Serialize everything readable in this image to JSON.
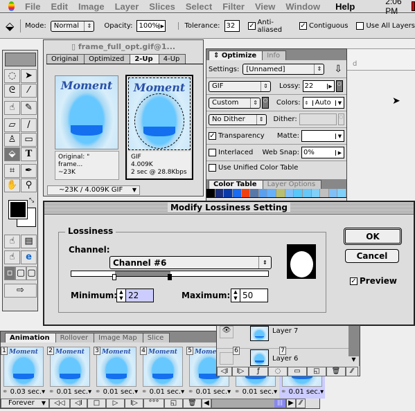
{
  "menubar": {
    "items": [
      "File",
      "Edit",
      "Image",
      "Layer",
      "Slices",
      "Select",
      "Filter",
      "View",
      "Window"
    ],
    "help": "Help",
    "clock": "2:06 PM"
  },
  "options": {
    "tool_icon": "paint-bucket-icon",
    "mode_label": "Mode:",
    "mode_value": "Normal",
    "opacity_label": "Opacity:",
    "opacity_value": "100%",
    "tolerance_label": "Tolerance:",
    "tolerance_value": "32",
    "anti_aliased": "Anti-aliased",
    "contiguous": "Contiguous",
    "use_all_layers": "Use All Layers"
  },
  "document": {
    "title": "frame_full_opt.gif@1...",
    "tabs": [
      "Original",
      "Optimized",
      "2-Up",
      "4-Up"
    ],
    "active_tab": "2-Up",
    "image_word": "Moment",
    "left_caption": [
      "Original: \" frame...",
      "~23K"
    ],
    "right_caption": [
      "GIF",
      "4.009K",
      "2 sec @ 28.8Kbps"
    ],
    "status": "~23K / 4.009K GIF"
  },
  "optimize": {
    "tabs": [
      "Optimize",
      "Info"
    ],
    "settings_label": "Settings:",
    "settings_value": "[Unnamed]",
    "format": "GIF",
    "lossy_label": "Lossy:",
    "lossy_value": "22",
    "palette": "Custom",
    "colors_label": "Colors:",
    "colors_value": "Auto",
    "dither_algo": "No Dither",
    "dither_label": "Dither:",
    "transparency": "Transparency",
    "transparency_checked": true,
    "matte_label": "Matte:",
    "interlaced": "Interlaced",
    "interlaced_checked": false,
    "websnap_label": "Web Snap:",
    "websnap_value": "0%",
    "unified": "Use Unified Color Table",
    "unified_checked": false
  },
  "color_table": {
    "tabs": [
      "Color Table",
      "Layer Options"
    ],
    "swatches": [
      "#000000",
      "#1a2e7a",
      "#0a3aa8",
      "#1a6cf0",
      "#f04010",
      "#5878a8",
      "#5aa0f0",
      "#68b0f8",
      "#b8c070",
      "#80c0f8",
      "#58c8f8",
      "#68c8f8",
      "#80d0f8",
      "#c0c0c0",
      "#80c0f8",
      "#80d0f8"
    ]
  },
  "dialog": {
    "title": "Modify Lossiness Setting",
    "group": "Lossiness",
    "channel_label": "Channel:",
    "channel_value": "Channel #6",
    "minimum_label": "Minimum:",
    "minimum_value": "22",
    "maximum_label": "Maximum:",
    "maximum_value": "50",
    "ok": "OK",
    "cancel": "Cancel",
    "preview": "Preview",
    "preview_checked": true,
    "range_min": 22,
    "range_max": 50,
    "range_scale": 100
  },
  "animation": {
    "tabs": [
      "Animation",
      "Rollover",
      "Image Map",
      "Slice"
    ],
    "frames": [
      {
        "n": "1",
        "delay": "0.03 sec."
      },
      {
        "n": "2",
        "delay": "0.01 sec."
      },
      {
        "n": "3",
        "delay": "0.01 sec."
      },
      {
        "n": "4",
        "delay": "0.01 sec."
      },
      {
        "n": "5",
        "delay": "0.01 sec."
      },
      {
        "n": "6",
        "delay": "0.01 sec."
      },
      {
        "n": "7",
        "delay": "0.01 sec."
      }
    ],
    "loop": "Forever",
    "selected_frame": 7
  },
  "layers": {
    "items": [
      "Layer 7",
      "Layer 6"
    ]
  }
}
